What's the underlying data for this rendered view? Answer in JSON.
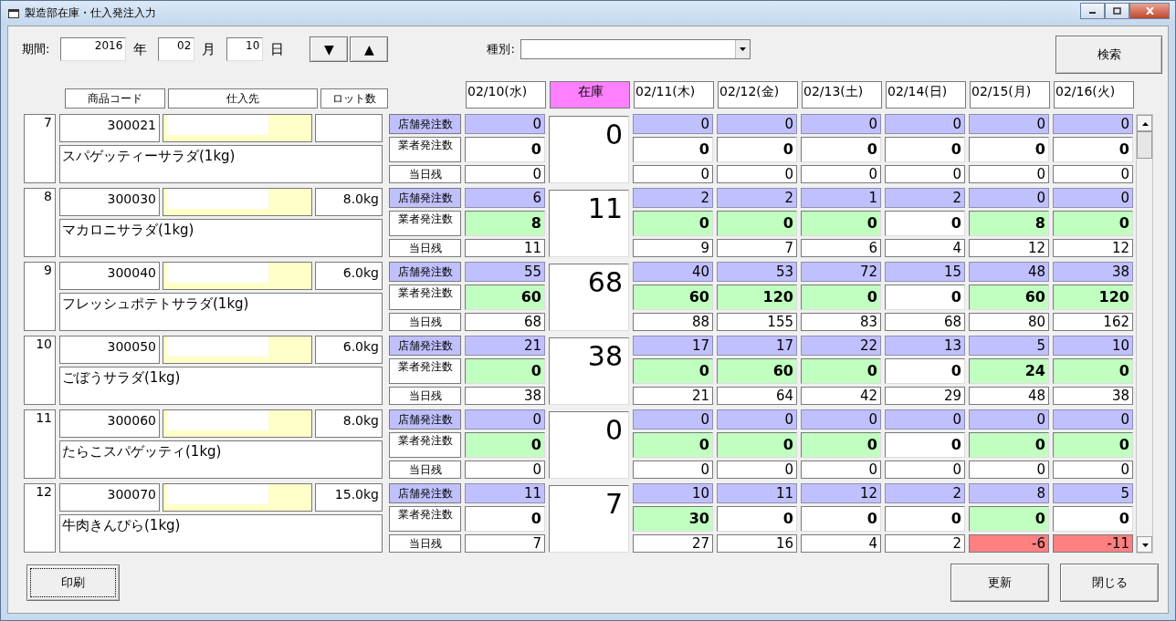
{
  "window": {
    "title": "製造部在庫・仕入発注入力"
  },
  "period": {
    "label": "期間:",
    "year": "2016",
    "year_unit": "年",
    "month": "02",
    "month_unit": "月",
    "day": "10",
    "day_unit": "日",
    "down_button": "▼",
    "up_button": "▲"
  },
  "category": {
    "label": "種別:"
  },
  "search_button": "検索",
  "columns": {
    "code": "商品コード",
    "supplier": "仕入先",
    "lot": "ロット数",
    "stock": "在庫",
    "dates": [
      "02/10(水)",
      "02/11(木)",
      "02/12(金)",
      "02/13(土)",
      "02/14(日)",
      "02/15(月)",
      "02/16(火)"
    ]
  },
  "items": [
    {
      "no": "7",
      "code": "300021",
      "name": "スパゲッティーサラダ(1kg)",
      "stock": "0",
      "labels": [
        "店舗発注数",
        "業者発注数",
        "当日残"
      ],
      "days": [
        {
          "store": "0",
          "vendor": "0",
          "highlighted": false,
          "remain": "0",
          "shortage": false
        },
        {
          "store": "0",
          "vendor": "0",
          "highlighted": false,
          "remain": "0",
          "shortage": false
        },
        {
          "store": "0",
          "vendor": "0",
          "highlighted": false,
          "remain": "0",
          "shortage": false
        },
        {
          "store": "0",
          "vendor": "0",
          "highlighted": false,
          "remain": "0",
          "shortage": false
        },
        {
          "store": "0",
          "vendor": "0",
          "highlighted": false,
          "remain": "0",
          "shortage": false
        },
        {
          "store": "0",
          "vendor": "0",
          "highlighted": false,
          "remain": "0",
          "shortage": false
        },
        {
          "store": "0",
          "vendor": "0",
          "highlighted": false,
          "remain": "0",
          "shortage": false
        }
      ]
    },
    {
      "no": "8",
      "code": "300030",
      "lot": "8.0kg",
      "name": "マカロニサラダ(1kg)",
      "stock": "11",
      "labels": [
        "店舗発注数",
        "業者発注数",
        "当日残"
      ],
      "days": [
        {
          "store": "6",
          "vendor": "8",
          "highlighted": true,
          "remain": "11",
          "shortage": false
        },
        {
          "store": "2",
          "vendor": "0",
          "highlighted": true,
          "remain": "9",
          "shortage": false
        },
        {
          "store": "2",
          "vendor": "0",
          "highlighted": true,
          "remain": "7",
          "shortage": false
        },
        {
          "store": "1",
          "vendor": "0",
          "highlighted": true,
          "remain": "6",
          "shortage": false
        },
        {
          "store": "2",
          "vendor": "0",
          "highlighted": false,
          "remain": "4",
          "shortage": false
        },
        {
          "store": "0",
          "vendor": "8",
          "highlighted": true,
          "remain": "12",
          "shortage": false
        },
        {
          "store": "0",
          "vendor": "0",
          "highlighted": true,
          "remain": "12",
          "shortage": false
        }
      ]
    },
    {
      "no": "9",
      "code": "300040",
      "lot": "6.0kg",
      "name": "フレッシュポテトサラダ(1kg)",
      "stock": "68",
      "labels": [
        "店舗発注数",
        "業者発注数",
        "当日残"
      ],
      "days": [
        {
          "store": "55",
          "vendor": "60",
          "highlighted": true,
          "remain": "68",
          "shortage": false
        },
        {
          "store": "40",
          "vendor": "60",
          "highlighted": true,
          "remain": "88",
          "shortage": false
        },
        {
          "store": "53",
          "vendor": "120",
          "highlighted": true,
          "remain": "155",
          "shortage": false
        },
        {
          "store": "72",
          "vendor": "0",
          "highlighted": true,
          "remain": "83",
          "shortage": false
        },
        {
          "store": "15",
          "vendor": "0",
          "highlighted": false,
          "remain": "68",
          "shortage": false
        },
        {
          "store": "48",
          "vendor": "60",
          "highlighted": true,
          "remain": "80",
          "shortage": false
        },
        {
          "store": "38",
          "vendor": "120",
          "highlighted": true,
          "remain": "162",
          "shortage": false
        }
      ]
    },
    {
      "no": "10",
      "code": "300050",
      "lot": "6.0kg",
      "name": "ごぼうサラダ(1kg)",
      "stock": "38",
      "labels": [
        "店舗発注数",
        "業者発注数",
        "当日残"
      ],
      "days": [
        {
          "store": "21",
          "vendor": "0",
          "highlighted": true,
          "remain": "38",
          "shortage": false
        },
        {
          "store": "17",
          "vendor": "0",
          "highlighted": true,
          "remain": "21",
          "shortage": false
        },
        {
          "store": "17",
          "vendor": "60",
          "highlighted": true,
          "remain": "64",
          "shortage": false
        },
        {
          "store": "22",
          "vendor": "0",
          "highlighted": true,
          "remain": "42",
          "shortage": false
        },
        {
          "store": "13",
          "vendor": "0",
          "highlighted": false,
          "remain": "29",
          "shortage": false
        },
        {
          "store": "5",
          "vendor": "24",
          "highlighted": true,
          "remain": "48",
          "shortage": false
        },
        {
          "store": "10",
          "vendor": "0",
          "highlighted": true,
          "remain": "38",
          "shortage": false
        }
      ]
    },
    {
      "no": "11",
      "code": "300060",
      "lot": "8.0kg",
      "name": "たらこスパゲッティ(1kg)",
      "stock": "0",
      "labels": [
        "店舗発注数",
        "業者発注数",
        "当日残"
      ],
      "days": [
        {
          "store": "0",
          "vendor": "0",
          "highlighted": true,
          "remain": "0",
          "shortage": false
        },
        {
          "store": "0",
          "vendor": "0",
          "highlighted": true,
          "remain": "0",
          "shortage": false
        },
        {
          "store": "0",
          "vendor": "0",
          "highlighted": true,
          "remain": "0",
          "shortage": false
        },
        {
          "store": "0",
          "vendor": "0",
          "highlighted": true,
          "remain": "0",
          "shortage": false
        },
        {
          "store": "0",
          "vendor": "0",
          "highlighted": false,
          "remain": "0",
          "shortage": false
        },
        {
          "store": "0",
          "vendor": "0",
          "highlighted": true,
          "remain": "0",
          "shortage": false
        },
        {
          "store": "0",
          "vendor": "0",
          "highlighted": true,
          "remain": "0",
          "shortage": false
        }
      ]
    },
    {
      "no": "12",
      "code": "300070",
      "lot": "15.0kg",
      "name": "牛肉きんぴら(1kg)",
      "stock": "7",
      "labels": [
        "店舗発注数",
        "業者発注数",
        "当日残"
      ],
      "days": [
        {
          "store": "11",
          "vendor": "0",
          "highlighted": false,
          "remain": "7",
          "shortage": false
        },
        {
          "store": "10",
          "vendor": "30",
          "highlighted": true,
          "remain": "27",
          "shortage": false
        },
        {
          "store": "11",
          "vendor": "0",
          "highlighted": false,
          "remain": "16",
          "shortage": false
        },
        {
          "store": "12",
          "vendor": "0",
          "highlighted": false,
          "remain": "4",
          "shortage": false
        },
        {
          "store": "2",
          "vendor": "0",
          "highlighted": false,
          "remain": "2",
          "shortage": false
        },
        {
          "store": "8",
          "vendor": "0",
          "highlighted": true,
          "remain": "-6",
          "shortage": true
        },
        {
          "store": "5",
          "vendor": "0",
          "highlighted": false,
          "remain": "-11",
          "shortage": true
        }
      ]
    }
  ],
  "buttons": {
    "print": "印刷",
    "update": "更新",
    "close": "閉じる"
  }
}
